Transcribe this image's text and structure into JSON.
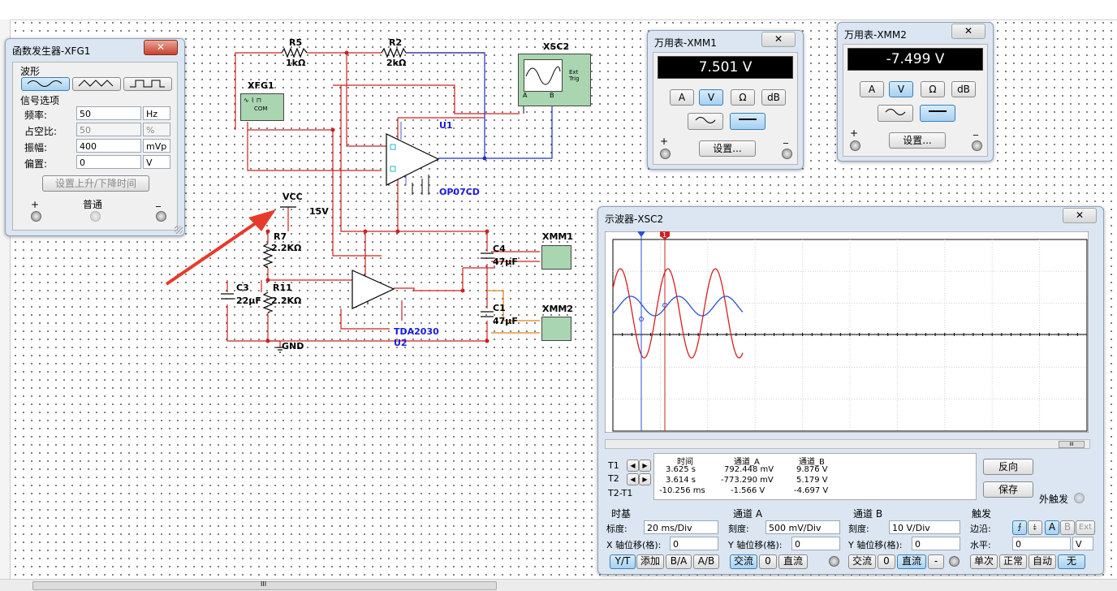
{
  "xfg1": {
    "title": "函数发生器-XFG1",
    "close": "✕",
    "waveform_group": "波形",
    "signal_group": "信号选项",
    "rows": [
      {
        "label": "频率:",
        "value": "50",
        "unit": "Hz"
      },
      {
        "label": "占空比:",
        "value": "50",
        "unit": "%"
      },
      {
        "label": "振幅:",
        "value": "400",
        "unit": "mVp"
      },
      {
        "label": "偏置:",
        "value": "0",
        "unit": "V"
      }
    ],
    "rise_fall_button": "设置上升/下降时间",
    "plus": "+",
    "common": "普通",
    "minus": "_"
  },
  "xmm1": {
    "title": "万用表-XMM1",
    "display": "7.501 V",
    "buttons": [
      "A",
      "V",
      "Ω",
      "dB"
    ],
    "settings": "设置...",
    "plus": "+",
    "minus": "_"
  },
  "xmm2": {
    "title": "万用表-XMM2",
    "display": "-7.499 V",
    "buttons": [
      "A",
      "V",
      "Ω",
      "dB"
    ],
    "settings": "设置...",
    "plus": "+",
    "minus": "_"
  },
  "circuit": {
    "labels": {
      "r5": "R5",
      "r5v": "1kΩ",
      "r2": "R2",
      "r2v": "2kΩ",
      "xfg1": "XFG1",
      "com": "COM",
      "xsc2": "XSC2",
      "ext_trig": "Ext Trig",
      "a": "A",
      "b": "B",
      "u1": "U1",
      "op07": "OP07CD",
      "vcc": "VCC",
      "v15": "15V",
      "r7": "R7",
      "r7v": "2.2KΩ",
      "r11": "R11",
      "r11v": "2.2KΩ",
      "c3": "C3",
      "c3v": "22μF",
      "c4": "C4",
      "c4v": "47μF",
      "c1": "C1",
      "c1v": "47μF",
      "xmm1": "XMM1",
      "xmm2": "XMM2",
      "tda": "TDA2030",
      "u2": "U2",
      "gnd": "GND"
    }
  },
  "scope": {
    "title": "示波器-XSC2",
    "t1": "T1",
    "t2": "T2",
    "t2t1": "T2-T1",
    "arrow_left": "◀",
    "arrow_right": "▶",
    "readout": {
      "headers": [
        "时间",
        "通道_A",
        "通道_B"
      ],
      "rows": [
        [
          "3.625 s",
          "792.448 mV",
          "9.876 V"
        ],
        [
          "3.614 s",
          "-773.290 mV",
          "5.179 V"
        ],
        [
          "-10.256 ms",
          "-1.566 V",
          "-4.697 V"
        ]
      ]
    },
    "reverse": "反向",
    "save": "保存",
    "ext_trigger": "外触发",
    "timebase": {
      "title": "时基",
      "scale_label": "标度:",
      "scale": "20 ms/Div",
      "xpos_label": "X 轴位移(格):",
      "xpos": "0",
      "buttons": [
        "Y/T",
        "添加",
        "B/A",
        "A/B"
      ]
    },
    "channel_a": {
      "title": "通道 A",
      "scale_label": "刻度:",
      "scale": "500 mV/Div",
      "ypos_label": "Y 轴位移(格):",
      "ypos": "0",
      "buttons": [
        "交流",
        "0",
        "直流"
      ]
    },
    "channel_b": {
      "title": "通道 B",
      "scale_label": "刻度:",
      "scale": "10  V/Div",
      "ypos_label": "Y 轴位移(格):",
      "ypos": "0",
      "buttons": [
        "交流",
        "0",
        "直流",
        "-"
      ]
    },
    "trigger": {
      "title": "触发",
      "edge_label": "边沿:",
      "level_label": "水平:",
      "level": "0",
      "level_unit": "V",
      "edge_buttons": [
        "A",
        "B",
        "Ext"
      ],
      "mode_buttons": [
        "单次",
        "正常",
        "自动",
        "无"
      ]
    },
    "cursor_markers": [
      "1",
      "2"
    ],
    "colors": {
      "channel_a": "#2a4fd8",
      "channel_b": "#d42020"
    }
  },
  "hscroll_mark": "III"
}
